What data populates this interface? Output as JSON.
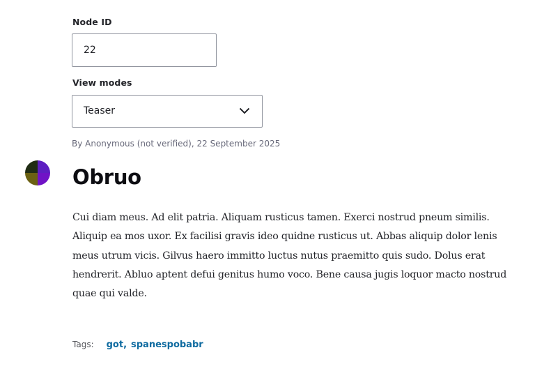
{
  "form": {
    "node_id": {
      "label": "Node ID",
      "value": "22"
    },
    "view_modes": {
      "label": "View modes",
      "selected": "Teaser"
    }
  },
  "article": {
    "submitted": "By Anonymous (not verified), 22 September 2025",
    "title": "Obruo",
    "body": "Cui diam meus. Ad elit patria. Aliquam rusticus tamen. Exerci nostrud pneum similis. Aliquip ea mos uxor. Ex facilisi gravis ideo quidne rusticus ut. Abbas aliquip dolor lenis meus utrum vicis. Gilvus haero immitto luctus nutus praemitto quis sudo. Dolus erat hendrerit. Abluo aptent defui genitus humo voco. Bene causa jugis loquor macto nos­trud quae qui valde.",
    "tags": {
      "label": "Tags:",
      "items": [
        "got",
        "spanespobabr"
      ],
      "separator": ","
    }
  },
  "colors": {
    "link": "#0f6ba0",
    "avatar": [
      "#202c14",
      "#5d1fc1",
      "#6b6112",
      "#7013c6"
    ]
  },
  "icons": {
    "select_arrow": "chevron-down-icon",
    "user_picture": "avatar"
  }
}
